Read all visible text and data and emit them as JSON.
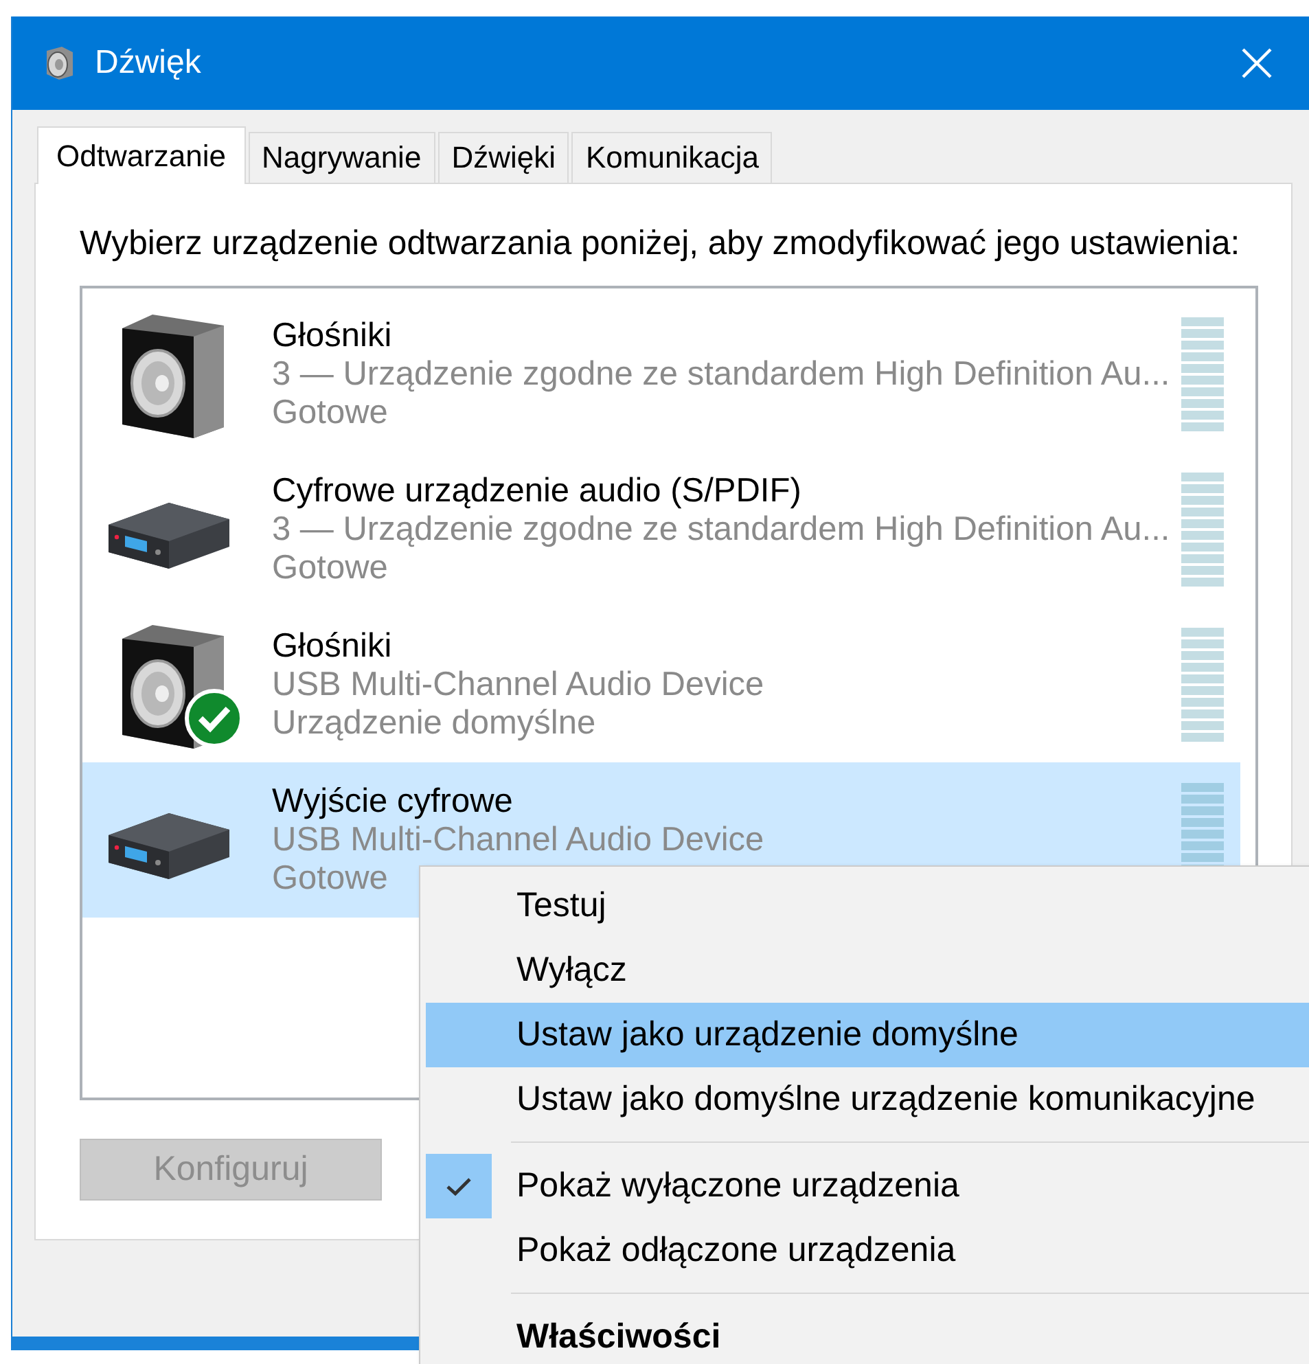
{
  "window": {
    "title": "Dźwięk"
  },
  "tabs": [
    {
      "label": "Odtwarzanie",
      "selected": true
    },
    {
      "label": "Nagrywanie",
      "selected": false
    },
    {
      "label": "Dźwięki",
      "selected": false
    },
    {
      "label": "Komunikacja",
      "selected": false
    }
  ],
  "instruction": "Wybierz urządzenie odtwarzania poniżej, aby zmodyfikować jego ustawienia:",
  "devices": [
    {
      "kind": "speaker",
      "name": "Głośniki",
      "description": "3 — Urządzenie zgodne ze standardem High Definition Au...",
      "status": "Gotowe",
      "default": false,
      "selected": false
    },
    {
      "kind": "receiver",
      "name": "Cyfrowe urządzenie audio (S/PDIF)",
      "description": "3 — Urządzenie zgodne ze standardem High Definition Au...",
      "status": "Gotowe",
      "default": false,
      "selected": false
    },
    {
      "kind": "speaker",
      "name": "Głośniki",
      "description": "USB Multi-Channel Audio Device",
      "status": "Urządzenie domyślne",
      "default": true,
      "selected": false
    },
    {
      "kind": "receiver",
      "name": "Wyjście cyfrowe",
      "description": "USB Multi-Channel Audio Device",
      "status": "Gotowe",
      "default": false,
      "selected": true
    }
  ],
  "configure_button": {
    "label": "Konfiguruj",
    "disabled": true
  },
  "context_menu": [
    {
      "kind": "item",
      "label": "Testuj",
      "checked": false,
      "selected": false,
      "bold": false
    },
    {
      "kind": "item",
      "label": "Wyłącz",
      "checked": false,
      "selected": false,
      "bold": false
    },
    {
      "kind": "item",
      "label": "Ustaw jako urządzenie domyślne",
      "checked": false,
      "selected": true,
      "bold": false
    },
    {
      "kind": "item",
      "label": "Ustaw jako domyślne urządzenie komunikacyjne",
      "checked": false,
      "selected": false,
      "bold": false
    },
    {
      "kind": "separator"
    },
    {
      "kind": "item",
      "label": "Pokaż wyłączone urządzenia",
      "checked": true,
      "selected": false,
      "bold": false
    },
    {
      "kind": "item",
      "label": "Pokaż odłączone urządzenia",
      "checked": false,
      "selected": false,
      "bold": false
    },
    {
      "kind": "separator"
    },
    {
      "kind": "item",
      "label": "Właściwości",
      "checked": false,
      "selected": false,
      "bold": true
    }
  ]
}
